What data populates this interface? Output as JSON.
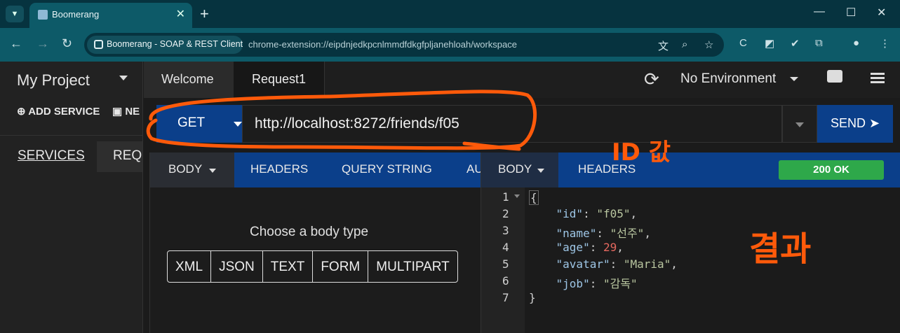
{
  "browser": {
    "tab_title": "Boomerang",
    "site_chip": "Boomerang - SOAP & REST Client",
    "url": "chrome-extension://eipdnjedkpcnlmmdfdkgfpljanehloah/workspace"
  },
  "sidebar": {
    "project": "My Project",
    "add_service": "ADD SERVICE",
    "new_label": "NE",
    "tab_services": "SERVICES",
    "tab_requests": "REQU"
  },
  "tabs": [
    {
      "label": "Welcome"
    },
    {
      "label": "Request1"
    }
  ],
  "environment": "No Environment",
  "request": {
    "method": "GET",
    "url": "http://localhost:8272/friends/f05",
    "send_label": "SEND ➤",
    "tabs": [
      "BODY",
      "HEADERS",
      "QUERY STRING",
      "AU"
    ],
    "body_type_label": "Choose a body type",
    "body_types": [
      "XML",
      "JSON",
      "TEXT",
      "FORM",
      "MULTIPART"
    ]
  },
  "response": {
    "tabs": [
      "BODY",
      "HEADERS"
    ],
    "status": "200 OK",
    "line_numbers": [
      "1",
      "2",
      "3",
      "4",
      "5",
      "6",
      "7"
    ],
    "json": {
      "open": "{",
      "close": "}",
      "fields": [
        {
          "key": "\"id\"",
          "value": "\"f05\"",
          "sep": ","
        },
        {
          "key": "\"name\"",
          "value": "\"선주\"",
          "sep": ","
        },
        {
          "key": "\"age\"",
          "value": "29",
          "sep": ","
        },
        {
          "key": "\"avatar\"",
          "value": "\"Maria\"",
          "sep": ","
        },
        {
          "key": "\"job\"",
          "value": "\"감독\"",
          "sep": ""
        }
      ]
    }
  },
  "annotations": {
    "id_value": "ID 값",
    "result": "결과"
  },
  "colors": {
    "accent": "#0b3f8a",
    "status_ok": "#2ea84a",
    "annotation": "#ff5a0a"
  }
}
